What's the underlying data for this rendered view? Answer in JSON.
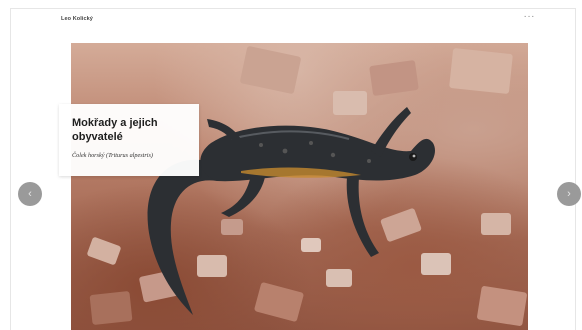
{
  "header": {
    "brand": "Leo Kolický",
    "menu_glyph": "···"
  },
  "slide": {
    "title": "Mokřady a jejich obyvatelé",
    "subtitle": "Čolek horský (Triturus alpestris)"
  },
  "nav": {
    "prev_glyph": "‹",
    "next_glyph": "›"
  },
  "colors": {
    "soil": "#b77d67",
    "newt_body": "#2c2f33",
    "nav_button": "#9a9a9a"
  }
}
